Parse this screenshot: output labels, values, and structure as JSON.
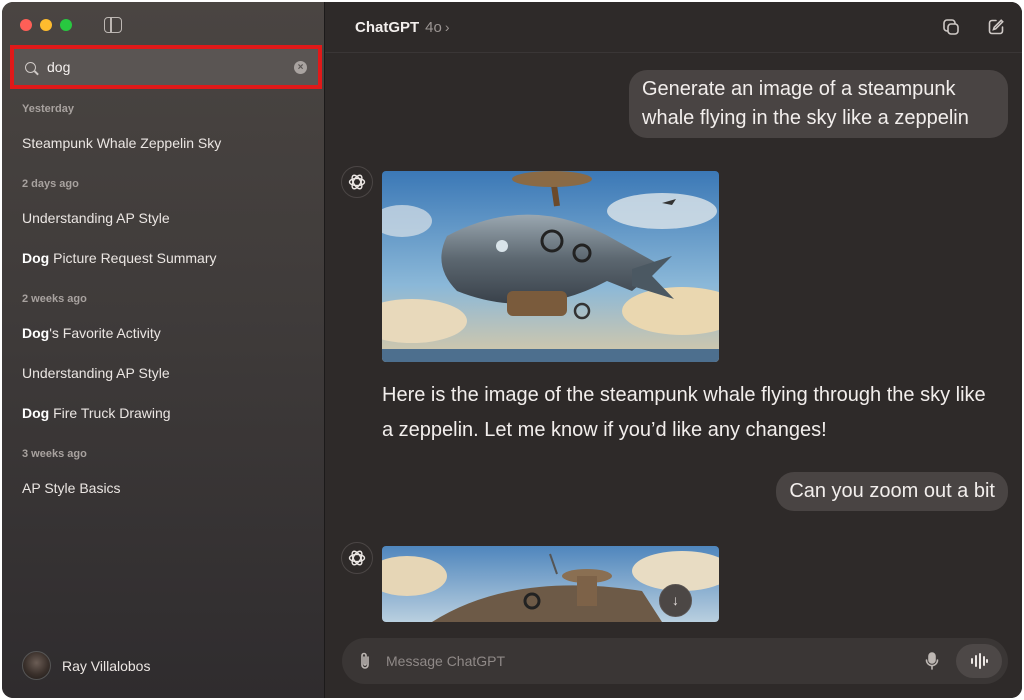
{
  "sidebar": {
    "search": {
      "value": "dog"
    },
    "groups": [
      {
        "label": "Yesterday",
        "items": [
          {
            "bold": "",
            "rest": "Steampunk Whale Zeppelin Sky"
          }
        ]
      },
      {
        "label": "2 days ago",
        "items": [
          {
            "bold": "",
            "rest": "Understanding AP Style"
          },
          {
            "bold": "Dog",
            "rest": " Picture Request Summary"
          }
        ]
      },
      {
        "label": "2 weeks ago",
        "items": [
          {
            "bold": "Dog",
            "rest": "'s Favorite Activity"
          },
          {
            "bold": "",
            "rest": "Understanding AP Style"
          },
          {
            "bold": "Dog",
            "rest": " Fire Truck Drawing"
          }
        ]
      },
      {
        "label": "3 weeks ago",
        "items": [
          {
            "bold": "",
            "rest": "AP Style Basics"
          }
        ]
      }
    ],
    "user": {
      "name": "Ray Villalobos"
    }
  },
  "header": {
    "title": "ChatGPT",
    "model": "4o",
    "chevron": "›"
  },
  "chat": {
    "user_message_1": "Generate an image of a steampunk whale flying in the sky like a zeppelin",
    "assistant_reply_1": "Here is the image of the steampunk whale flying through the sky like a zeppelin. Let me know if you’d like any changes!",
    "user_message_2": "Can you zoom out a bit",
    "scroll_down_glyph": "↓"
  },
  "composer": {
    "placeholder": "Message ChatGPT"
  },
  "colors": {
    "search_highlight_border": "#e01919",
    "close_dot": "#fe5f57",
    "minimize_dot": "#febc2e",
    "zoom_dot": "#28c840"
  }
}
